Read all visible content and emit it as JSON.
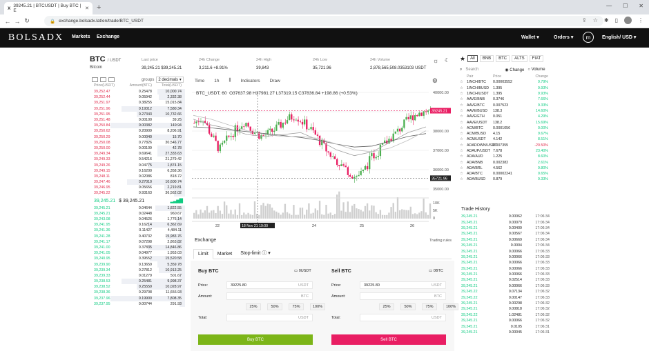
{
  "browser": {
    "tab_title": "39245.21 | BTCUSDT | Buy BTC | E",
    "url": "exchange.bolsadx.lat/en/trade/BTC_USDT"
  },
  "site": {
    "logo": "BOLSADX",
    "markets": "Markets",
    "exchange": "Exchange",
    "wallet": "Wallet",
    "orders": "Orders",
    "avatar": "m",
    "lang": "English/ USD"
  },
  "ticker": {
    "pair": "BTC",
    "pair_quote": "/ USDT",
    "name": "Bitcoin",
    "last_price_label": "Last price",
    "last_price": "39,245.21 $39,245.21",
    "change_label": "24h Change",
    "change": "3,211.6 +8.91%",
    "high_label": "24h High",
    "high": "39,843",
    "low_label": "24h Low",
    "low": "35,721.96",
    "volume_label": "24h Volume",
    "volume": "2,878,565,508.0353103 USDT"
  },
  "orderbook": {
    "groups_label": "groups",
    "decimals": "2 decimals",
    "col_price": "Price(USDT)",
    "col_amount": "Amount(BTC)",
    "col_total": "Total(USDT)",
    "asks": [
      [
        "39,252.47",
        "0.25478",
        "10,000.74"
      ],
      [
        "39,252.44",
        "0.05942",
        "2,332.38"
      ],
      [
        "39,251.97",
        "0.38255",
        "15,015.84"
      ],
      [
        "39,251.96",
        "0.19312",
        "7,580.34"
      ],
      [
        "39,251.95",
        "0.27343",
        "10,732.66"
      ],
      [
        "39,251.48",
        "0.00100",
        "39.25"
      ],
      [
        "39,250.84",
        "0.00382",
        "149.94"
      ],
      [
        "39,250.62",
        "0.20909",
        "8,206.91"
      ],
      [
        "39,250.29",
        "0.00040",
        "15.70"
      ],
      [
        "39,250.08",
        "0.77826",
        "30,546.77"
      ],
      [
        "39,250.00",
        "0.00109",
        "42.78"
      ],
      [
        "39,249.34",
        "0.69641",
        "27,333.63"
      ],
      [
        "39,249.33",
        "0.54216",
        "21,279.42"
      ],
      [
        "39,249.26",
        "0.04775",
        "1,874.15"
      ],
      [
        "39,249.15",
        "0.16200",
        "6,358.36"
      ],
      [
        "39,248.11",
        "0.02086",
        "818.72"
      ],
      [
        "39,247.46",
        "0.27010",
        "10,600.74"
      ],
      [
        "39,246.95",
        "0.05656",
        "2,219.81"
      ],
      [
        "39,245.22",
        "0.93163",
        "36,562.02"
      ]
    ],
    "mid_price": "39,245.21",
    "mid_usd": "$ 39,245.21",
    "bids": [
      [
        "39,245.21",
        "0.04644",
        "1,822.55"
      ],
      [
        "39,245.21",
        "0.02448",
        "960.67"
      ],
      [
        "39,243.08",
        "0.04526",
        "1,776.14"
      ],
      [
        "39,241.95",
        "0.16214",
        "6,362.69"
      ],
      [
        "39,241.36",
        "0.11427",
        "4,484.11"
      ],
      [
        "39,241.28",
        "0.40732",
        "15,983.76"
      ],
      [
        "39,241.17",
        "0.07298",
        "2,863.82"
      ],
      [
        "39,241.00",
        "0.37835",
        "14,846.86"
      ],
      [
        "39,241.05",
        "0.04977",
        "1,953.03"
      ],
      [
        "39,240.95",
        "0.39552",
        "15,520.58"
      ],
      [
        "39,239.90",
        "0.13659",
        "5,359.78"
      ],
      [
        "39,239.34",
        "0.27812",
        "10,913.25"
      ],
      [
        "39,239.33",
        "0.01279",
        "501.67"
      ],
      [
        "39,238.53",
        "0.25481",
        "9,998.37"
      ],
      [
        "39,238.52",
        "0.25559",
        "10,028.97"
      ],
      [
        "39,238.36",
        "0.29708",
        "11,656.93"
      ],
      [
        "39,237.96",
        "0.19900",
        "7,808.35"
      ],
      [
        "39,237.95",
        "0.00744",
        "291.93"
      ]
    ]
  },
  "chart": {
    "tab_time": "Time",
    "tab_interval": "1h",
    "tab_indicators": "Indicators",
    "tab_draw": "Draw",
    "symbol_label": "BTC_USDT, 60",
    "ohlc": "O37637.98 H37981.27 L37319.15 C37836.84 +198.86 (+0.53%)",
    "price_ticks": [
      "40000.00",
      "39000.00",
      "38000.00",
      "37000.00",
      "36000.00",
      "35000.00"
    ],
    "last_tag": "39245.21",
    "low_tag": "35721.96",
    "vol_ticks": [
      "10K",
      "5K",
      "0"
    ],
    "date_ticks": [
      "22",
      "24",
      "25",
      "26"
    ],
    "date_tag": "18 Nov 21 19:00"
  },
  "exchange": {
    "title": "Exchange",
    "trading_rules": "Trading rules",
    "tab_limit": "Limit",
    "tab_market": "Market",
    "tab_stoplimit": "Stop-limit",
    "buy_title": "Buy BTC",
    "buy_balance": "0USDT",
    "sell_title": "Sell BTC",
    "sell_balance": "0BTC",
    "price_label": "Price:",
    "amount_label": "Amount:",
    "total_label": "Total:",
    "buy_price": "39225.80",
    "sell_price": "39225.80",
    "unit_usdt": "USDT",
    "unit_btc": "BTC",
    "pcts": [
      "25%",
      "50%",
      "75%",
      "100%"
    ],
    "buy_button": "Buy BTC",
    "sell_button": "Sell BTC",
    "buy_color": "#7cb518",
    "sell_color": "#e91e63"
  },
  "market": {
    "filters": [
      "All",
      "BNB",
      "BTC",
      "ALTS",
      "FIAT"
    ],
    "search_placeholder": "Search",
    "change_toggle": "Change",
    "volume_toggle": "Volume",
    "col_pair": "Pair",
    "col_price": "Price",
    "col_change": "Change",
    "rows": [
      [
        "1INCH/BTC",
        "0.00003552",
        "9.79%"
      ],
      [
        "1INCH/BUSD",
        "1.395",
        "9.93%"
      ],
      [
        "1INCH/USDT",
        "1.395",
        "9.93%"
      ],
      [
        "AAVE/BNB",
        "0.3746",
        "7.66%"
      ],
      [
        "AAVE/BTC",
        "0.007523",
        "9.33%"
      ],
      [
        "AAVE/BUSD",
        "138.3",
        "14.60%"
      ],
      [
        "AAVE/ETH",
        "0.051",
        "4.29%"
      ],
      [
        "AAVE/USDT",
        "138.2",
        "15.69%"
      ],
      [
        "ACM/BTC",
        "0.0001056",
        "0.00%"
      ],
      [
        "ACM/BUSD",
        "4.15",
        "9.67%"
      ],
      [
        "ACM/USDT",
        "4.142",
        "8.51%"
      ],
      [
        "ADADOWN/USDT",
        "0.007355",
        "-20.50%"
      ],
      [
        "ADAUP/USDT",
        "7.678",
        "23.40%"
      ],
      [
        "ADA/AUD",
        "1.225",
        "8.60%"
      ],
      [
        "ADA/BNB",
        "0.002382",
        "2.61%"
      ],
      [
        "ADA/BRL",
        "4.562",
        "9.80%"
      ],
      [
        "ADA/BTC",
        "0.00002241",
        "0.65%"
      ],
      [
        "ADA/BUSD",
        "0.879",
        "9.33%"
      ]
    ]
  },
  "trades": {
    "title": "Trade History",
    "rows": [
      [
        "39,245.21",
        "0.00062",
        "17:06:34"
      ],
      [
        "39,245.21",
        "0.00079",
        "17:06:34"
      ],
      [
        "39,245.21",
        "0.00409",
        "17:06:34"
      ],
      [
        "39,245.21",
        "0.00567",
        "17:06:34"
      ],
      [
        "39,245.21",
        "0.00669",
        "17:06:34"
      ],
      [
        "39,245.21",
        "0.0004",
        "17:06:34"
      ],
      [
        "39,245.21",
        "0.00066",
        "17:06:33"
      ],
      [
        "39,245.21",
        "0.00066",
        "17:06:33"
      ],
      [
        "39,245.21",
        "0.00066",
        "17:06:33"
      ],
      [
        "39,245.21",
        "0.00066",
        "17:06:33"
      ],
      [
        "39,245.21",
        "0.00066",
        "17:06:33"
      ],
      [
        "39,245.21",
        "0.02514",
        "17:06:33"
      ],
      [
        "39,245.21",
        "0.00066",
        "17:06:33"
      ],
      [
        "39,245.22",
        "0.07134",
        "17:06:32"
      ],
      [
        "39,245.22",
        "0.00147",
        "17:06:33"
      ],
      [
        "39,245.21",
        "0.00298",
        "17:06:32"
      ],
      [
        "39,245.21",
        "0.00818",
        "17:06:32"
      ],
      [
        "39,245.22",
        "1.02481",
        "17:06:32"
      ],
      [
        "39,245.21",
        "0.00066",
        "17:06:32"
      ],
      [
        "39,245.21",
        "0.0105",
        "17:06:31"
      ],
      [
        "39,245.21",
        "0.00045",
        "17:06:31"
      ]
    ]
  }
}
